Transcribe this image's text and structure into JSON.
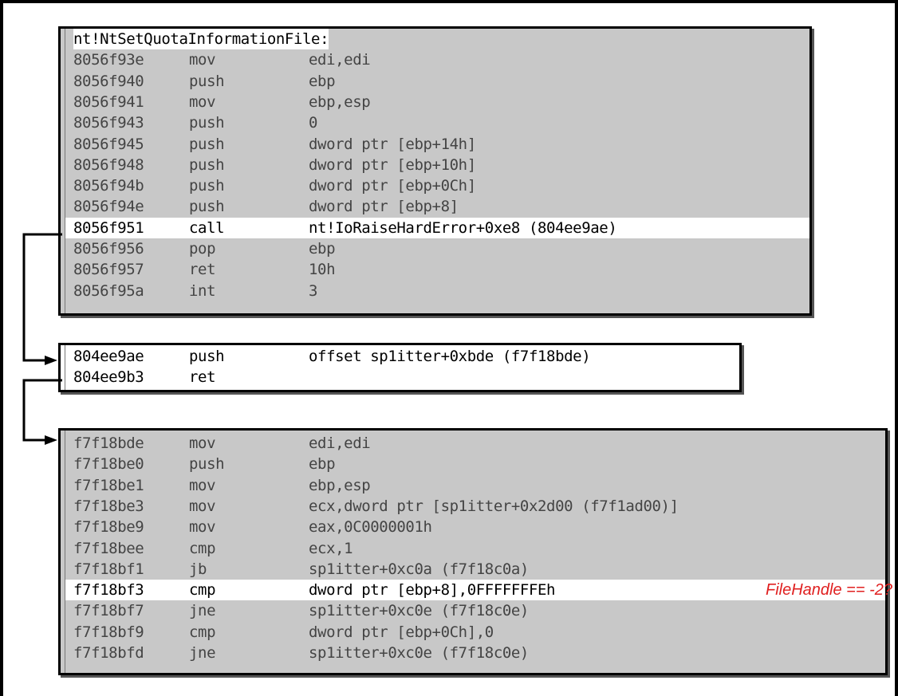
{
  "blocks": [
    {
      "header": "nt!NtSetQuotaInformationFile:",
      "rows": [
        {
          "addr": "8056f93e",
          "op": "mov",
          "arg": "edi,edi",
          "hl": false,
          "note": ""
        },
        {
          "addr": "8056f940",
          "op": "push",
          "arg": "ebp",
          "hl": false,
          "note": ""
        },
        {
          "addr": "8056f941",
          "op": "mov",
          "arg": "ebp,esp",
          "hl": false,
          "note": ""
        },
        {
          "addr": "8056f943",
          "op": "push",
          "arg": "0",
          "hl": false,
          "note": ""
        },
        {
          "addr": "8056f945",
          "op": "push",
          "arg": "dword ptr [ebp+14h]",
          "hl": false,
          "note": ""
        },
        {
          "addr": "8056f948",
          "op": "push",
          "arg": "dword ptr [ebp+10h]",
          "hl": false,
          "note": ""
        },
        {
          "addr": "8056f94b",
          "op": "push",
          "arg": "dword ptr [ebp+0Ch]",
          "hl": false,
          "note": ""
        },
        {
          "addr": "8056f94e",
          "op": "push",
          "arg": "dword ptr [ebp+8]",
          "hl": false,
          "note": ""
        },
        {
          "addr": "8056f951",
          "op": "call",
          "arg": "nt!IoRaiseHardError+0xe8 (804ee9ae)",
          "hl": true,
          "note": ""
        },
        {
          "addr": "8056f956",
          "op": "pop",
          "arg": "ebp",
          "hl": false,
          "note": ""
        },
        {
          "addr": "8056f957",
          "op": "ret",
          "arg": "10h",
          "hl": false,
          "note": ""
        },
        {
          "addr": "8056f95a",
          "op": "int",
          "arg": "3",
          "hl": false,
          "note": ""
        }
      ]
    },
    {
      "header": "",
      "rows": [
        {
          "addr": "804ee9ae",
          "op": "push",
          "arg": "offset sp1itter+0xbde (f7f18bde)",
          "hl": false,
          "note": ""
        },
        {
          "addr": "804ee9b3",
          "op": "ret",
          "arg": "",
          "hl": false,
          "note": ""
        }
      ]
    },
    {
      "header": "",
      "rows": [
        {
          "addr": "f7f18bde",
          "op": "mov",
          "arg": "edi,edi",
          "hl": false,
          "note": ""
        },
        {
          "addr": "f7f18be0",
          "op": "push",
          "arg": "ebp",
          "hl": false,
          "note": ""
        },
        {
          "addr": "f7f18be1",
          "op": "mov",
          "arg": "ebp,esp",
          "hl": false,
          "note": ""
        },
        {
          "addr": "f7f18be3",
          "op": "mov",
          "arg": "ecx,dword ptr [sp1itter+0x2d00 (f7f1ad00)]",
          "hl": false,
          "note": ""
        },
        {
          "addr": "f7f18be9",
          "op": "mov",
          "arg": "eax,0C0000001h",
          "hl": false,
          "note": ""
        },
        {
          "addr": "f7f18bee",
          "op": "cmp",
          "arg": "ecx,1",
          "hl": false,
          "note": ""
        },
        {
          "addr": "f7f18bf1",
          "op": "jb",
          "arg": "sp1itter+0xc0a (f7f18c0a)",
          "hl": false,
          "note": ""
        },
        {
          "addr": "f7f18bf3",
          "op": "cmp",
          "arg": "dword ptr [ebp+8],0FFFFFFFEh",
          "hl": true,
          "note": "FileHandle == -2?"
        },
        {
          "addr": "f7f18bf7",
          "op": "jne",
          "arg": "sp1itter+0xc0e (f7f18c0e)",
          "hl": false,
          "note": ""
        },
        {
          "addr": "f7f18bf9",
          "op": "cmp",
          "arg": "dword ptr [ebp+0Ch],0",
          "hl": false,
          "note": ""
        },
        {
          "addr": "f7f18bfd",
          "op": "jne",
          "arg": "sp1itter+0xc0e (f7f18c0e)",
          "hl": false,
          "note": ""
        }
      ]
    }
  ]
}
